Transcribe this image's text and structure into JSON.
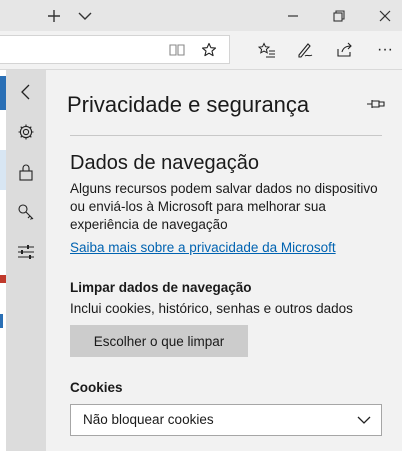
{
  "titlebar": {
    "new_tab_glyph": "+",
    "icons": [
      "plus-icon",
      "chevron-down-icon",
      "minimize-icon",
      "restore-icon",
      "close-icon"
    ]
  },
  "toolbar": {
    "icons": [
      "reading-view-icon",
      "favorite-star-icon",
      "favorites-list-icon",
      "pen-icon",
      "share-icon",
      "more-icon"
    ],
    "more_glyph": "···"
  },
  "rail": {
    "icons": [
      "back-icon",
      "settings-gear-icon",
      "lock-icon",
      "key-icon",
      "sliders-icon"
    ]
  },
  "panel": {
    "title": "Privacidade e segurança",
    "section_title": "Dados de navegação",
    "description": "Alguns recursos podem salvar dados no dispositivo ou enviá-los à Microsoft para melhorar sua experiência de navegação",
    "learn_more_link": "Saiba mais sobre a privacidade da Microsoft",
    "clear_heading": "Limpar dados de navegação",
    "clear_description": "Inclui cookies, histórico, senhas e outros dados",
    "clear_button": "Escolher o que limpar",
    "cookies_label": "Cookies",
    "cookies_value": "Não bloquear cookies"
  },
  "colors": {
    "accent": "#0063b1",
    "rail_bg": "#dcdcdc",
    "panel_bg": "#f2f2f2",
    "button_bg": "#cccccc",
    "page_edge_blue": "#2a6fb5",
    "page_edge_red": "#c0392b"
  }
}
